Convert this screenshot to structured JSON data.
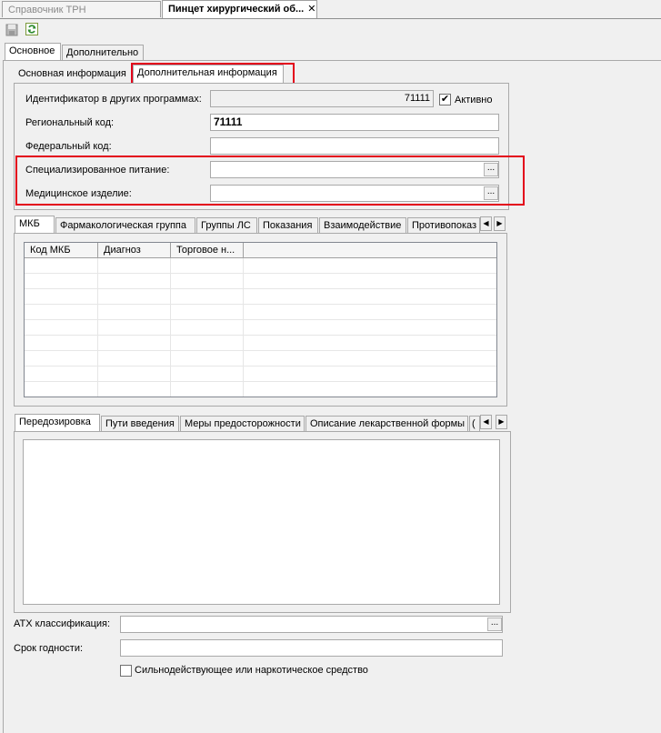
{
  "doc_tabs": [
    {
      "label": "Справочник ТРН",
      "active": false
    },
    {
      "label": "Пинцет хирургический об...",
      "active": true
    }
  ],
  "close_glyph": "✕",
  "toolbar": {
    "save_icon": "save-icon",
    "refresh_icon": "refresh-icon"
  },
  "main_tabs": [
    "Основное",
    "Дополнительно"
  ],
  "info_tabs": [
    "Основная информация",
    "Дополнительная информация"
  ],
  "fields": {
    "external_id_label": "Идентификатор в других программах:",
    "external_id_value": "71111",
    "active_label": "Активно",
    "active_checked": "✔",
    "regional_code_label": "Региональный код:",
    "regional_code_value": "71111",
    "federal_code_label": "Федеральный код:",
    "federal_code_value": "",
    "special_nutrition_label": "Специализированное питание:",
    "special_nutrition_value": "",
    "medical_device_label": "Медицинское изделие:",
    "medical_device_value": ""
  },
  "ellipsis": "...",
  "mkb_tabs": [
    "МКБ",
    "Фармакологическая группа",
    "Группы ЛС",
    "Показания",
    "Взаимодействие",
    "Противопоказ"
  ],
  "mkb_grid": {
    "columns": [
      "Код МКБ",
      "Диагноз",
      "Торговое н..."
    ]
  },
  "arrows": {
    "left": "◀",
    "right": "▶"
  },
  "overdose_tabs": [
    "Передозировка",
    "Пути введения",
    "Меры предосторожности",
    "Описание лекарственной формы",
    "("
  ],
  "atc_label": "АТХ классификация:",
  "atc_value": "",
  "shelf_life_label": "Срок годности:",
  "shelf_life_value": "",
  "potent_label": "Сильнодействующее или наркотическое средство",
  "colors": {
    "highlight": "#e3001b",
    "background": "#f0f0f0"
  }
}
